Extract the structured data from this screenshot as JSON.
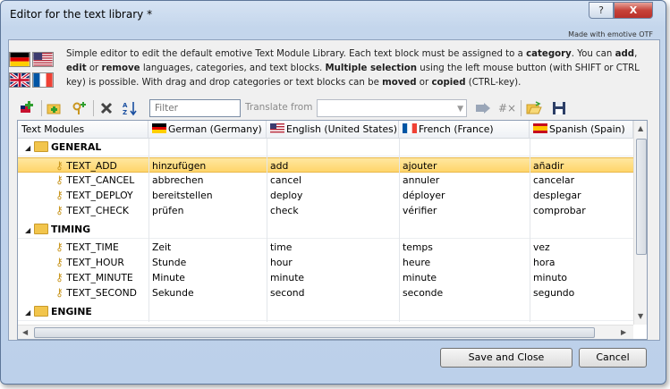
{
  "window": {
    "title": "Editor for the text library *",
    "help_label": "?",
    "close_label": "X",
    "made_with": "Made with emotive OTF"
  },
  "description": {
    "p1": "Simple editor to edit the default emotive Text Module Library. Each text block must be assigned to a ",
    "b1": "category",
    "p2": ". You can ",
    "b2": "add",
    "p3": ", ",
    "b3": "edit",
    "p4": " or ",
    "b4": "remove",
    "p5": " languages, categories, and text blocks. ",
    "b5": "Multiple selection",
    "p6": " using the left mouse button (with SHIFT or CTRL key) is possible. With drag and drop categories or text blocks can be ",
    "b6": "moved",
    "p7": " or ",
    "b7": "copied",
    "p8": " (CTRL-key)."
  },
  "toolbar": {
    "filter_placeholder": "Filter",
    "translate_label": "Translate from",
    "translate_value": "",
    "translate_hashtag_label": "#×"
  },
  "grid": {
    "columns": [
      "Text Modules",
      "German (Germany)",
      "English (United States)",
      "French (France)",
      "Spanish (Spain)"
    ],
    "categories": [
      {
        "name": "GENERAL",
        "items": [
          {
            "key": "TEXT_ADD",
            "de": "hinzufügen",
            "en": "add",
            "fr": "ajouter",
            "es": "añadir"
          },
          {
            "key": "TEXT_CANCEL",
            "de": "abbrechen",
            "en": "cancel",
            "fr": "annuler",
            "es": "cancelar"
          },
          {
            "key": "TEXT_DEPLOY",
            "de": "bereitstellen",
            "en": "deploy",
            "fr": "déployer",
            "es": "desplegar"
          },
          {
            "key": "TEXT_CHECK",
            "de": "prüfen",
            "en": "check",
            "fr": "vérifier",
            "es": "comprobar"
          }
        ]
      },
      {
        "name": "TIMING",
        "items": [
          {
            "key": "TEXT_TIME",
            "de": "Zeit",
            "en": "time",
            "fr": "temps",
            "es": "vez"
          },
          {
            "key": "TEXT_HOUR",
            "de": "Stunde",
            "en": "hour",
            "fr": "heure",
            "es": "hora"
          },
          {
            "key": "TEXT_MINUTE",
            "de": "Minute",
            "en": "minute",
            "fr": "minute",
            "es": "minuto"
          },
          {
            "key": "TEXT_SECOND",
            "de": "Sekunde",
            "en": "second",
            "fr": "seconde",
            "es": "segundo"
          }
        ]
      },
      {
        "name": "ENGINE",
        "items": []
      }
    ],
    "selected_key": "TEXT_ADD"
  },
  "buttons": {
    "save_close": "Save and Close",
    "cancel": "Cancel"
  },
  "colors": {
    "selection": "#ffd56a",
    "folder": "#f2c54c",
    "key_icon": "#c9961f"
  }
}
